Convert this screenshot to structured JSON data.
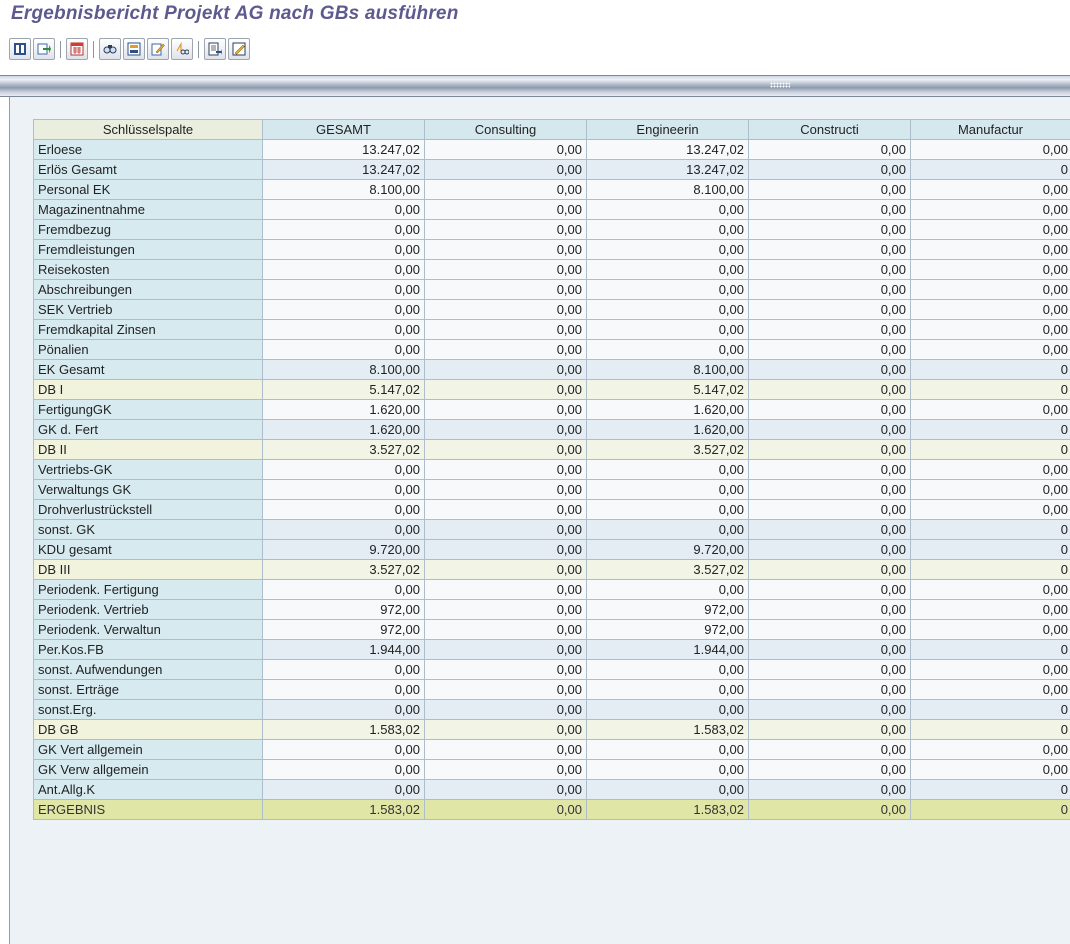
{
  "title": "Ergebnisbericht Projekt AG nach GBs ausführen",
  "toolbar": {
    "buttons": [
      {
        "icon": "info-icon"
      },
      {
        "icon": "refresh-icon"
      },
      {
        "icon": "spreadsheet-icon"
      },
      {
        "icon": "find-icon"
      },
      {
        "icon": "layout-icon"
      },
      {
        "icon": "edit-icon"
      },
      {
        "icon": "percent-icon"
      },
      {
        "icon": "export-icon"
      },
      {
        "icon": "change-icon"
      }
    ]
  },
  "table": {
    "headers": [
      "Schlüsselspalte",
      "GESAMT",
      "Consulting",
      "Engineerin",
      "Constructi",
      "Manufactur"
    ],
    "rows": [
      {
        "label": "Erloese",
        "values": [
          "13.247,02",
          "0,00",
          "13.247,02",
          "0,00",
          "0,00"
        ],
        "style": "normal"
      },
      {
        "label": "Erlös Gesamt",
        "values": [
          "13.247,02",
          "0,00",
          "13.247,02",
          "0,00",
          "0"
        ],
        "style": "sub"
      },
      {
        "label": "Personal EK",
        "values": [
          "8.100,00",
          "0,00",
          "8.100,00",
          "0,00",
          "0,00"
        ],
        "style": "normal"
      },
      {
        "label": "Magazinentnahme",
        "values": [
          "0,00",
          "0,00",
          "0,00",
          "0,00",
          "0,00"
        ],
        "style": "normal"
      },
      {
        "label": "Fremdbezug",
        "values": [
          "0,00",
          "0,00",
          "0,00",
          "0,00",
          "0,00"
        ],
        "style": "normal"
      },
      {
        "label": "Fremdleistungen",
        "values": [
          "0,00",
          "0,00",
          "0,00",
          "0,00",
          "0,00"
        ],
        "style": "normal"
      },
      {
        "label": "Reisekosten",
        "values": [
          "0,00",
          "0,00",
          "0,00",
          "0,00",
          "0,00"
        ],
        "style": "normal"
      },
      {
        "label": "Abschreibungen",
        "values": [
          "0,00",
          "0,00",
          "0,00",
          "0,00",
          "0,00"
        ],
        "style": "normal"
      },
      {
        "label": "SEK Vertrieb",
        "values": [
          "0,00",
          "0,00",
          "0,00",
          "0,00",
          "0,00"
        ],
        "style": "normal"
      },
      {
        "label": "Fremdkapital Zinsen",
        "values": [
          "0,00",
          "0,00",
          "0,00",
          "0,00",
          "0,00"
        ],
        "style": "normal"
      },
      {
        "label": "Pönalien",
        "values": [
          "0,00",
          "0,00",
          "0,00",
          "0,00",
          "0,00"
        ],
        "style": "normal"
      },
      {
        "label": "EK Gesamt",
        "values": [
          "8.100,00",
          "0,00",
          "8.100,00",
          "0,00",
          "0"
        ],
        "style": "sub"
      },
      {
        "label": "DB I",
        "values": [
          "5.147,02",
          "0,00",
          "5.147,02",
          "0,00",
          "0"
        ],
        "style": "tot"
      },
      {
        "label": "FertigungGK",
        "values": [
          "1.620,00",
          "0,00",
          "1.620,00",
          "0,00",
          "0,00"
        ],
        "style": "normal"
      },
      {
        "label": "GK d. Fert",
        "values": [
          "1.620,00",
          "0,00",
          "1.620,00",
          "0,00",
          "0"
        ],
        "style": "sub"
      },
      {
        "label": "DB II",
        "values": [
          "3.527,02",
          "0,00",
          "3.527,02",
          "0,00",
          "0"
        ],
        "style": "tot"
      },
      {
        "label": "Vertriebs-GK",
        "values": [
          "0,00",
          "0,00",
          "0,00",
          "0,00",
          "0,00"
        ],
        "style": "normal"
      },
      {
        "label": "Verwaltungs GK",
        "values": [
          "0,00",
          "0,00",
          "0,00",
          "0,00",
          "0,00"
        ],
        "style": "normal"
      },
      {
        "label": "Drohverlustrückstell",
        "values": [
          "0,00",
          "0,00",
          "0,00",
          "0,00",
          "0,00"
        ],
        "style": "normal"
      },
      {
        "label": "sonst. GK",
        "values": [
          "0,00",
          "0,00",
          "0,00",
          "0,00",
          "0"
        ],
        "style": "sub"
      },
      {
        "label": "KDU gesamt",
        "values": [
          "9.720,00",
          "0,00",
          "9.720,00",
          "0,00",
          "0"
        ],
        "style": "sub"
      },
      {
        "label": "DB III",
        "values": [
          "3.527,02",
          "0,00",
          "3.527,02",
          "0,00",
          "0"
        ],
        "style": "tot"
      },
      {
        "label": "Periodenk. Fertigung",
        "values": [
          "0,00",
          "0,00",
          "0,00",
          "0,00",
          "0,00"
        ],
        "style": "normal"
      },
      {
        "label": "Periodenk. Vertrieb",
        "values": [
          "972,00",
          "0,00",
          "972,00",
          "0,00",
          "0,00"
        ],
        "style": "normal"
      },
      {
        "label": "Periodenk. Verwaltun",
        "values": [
          "972,00",
          "0,00",
          "972,00",
          "0,00",
          "0,00"
        ],
        "style": "normal"
      },
      {
        "label": "Per.Kos.FB",
        "values": [
          "1.944,00",
          "0,00",
          "1.944,00",
          "0,00",
          "0"
        ],
        "style": "sub"
      },
      {
        "label": "sonst. Aufwendungen",
        "values": [
          "0,00",
          "0,00",
          "0,00",
          "0,00",
          "0,00"
        ],
        "style": "normal"
      },
      {
        "label": "sonst. Erträge",
        "values": [
          "0,00",
          "0,00",
          "0,00",
          "0,00",
          "0,00"
        ],
        "style": "normal"
      },
      {
        "label": "sonst.Erg.",
        "values": [
          "0,00",
          "0,00",
          "0,00",
          "0,00",
          "0"
        ],
        "style": "sub"
      },
      {
        "label": "DB GB",
        "values": [
          "1.583,02",
          "0,00",
          "1.583,02",
          "0,00",
          "0"
        ],
        "style": "tot"
      },
      {
        "label": "GK Vert allgemein",
        "values": [
          "0,00",
          "0,00",
          "0,00",
          "0,00",
          "0,00"
        ],
        "style": "normal"
      },
      {
        "label": "GK Verw allgemein",
        "values": [
          "0,00",
          "0,00",
          "0,00",
          "0,00",
          "0,00"
        ],
        "style": "normal"
      },
      {
        "label": "Ant.Allg.K",
        "values": [
          "0,00",
          "0,00",
          "0,00",
          "0,00",
          "0"
        ],
        "style": "sub"
      },
      {
        "label": "ERGEBNIS",
        "values": [
          "1.583,02",
          "0,00",
          "1.583,02",
          "0,00",
          "0"
        ],
        "style": "final"
      }
    ]
  }
}
